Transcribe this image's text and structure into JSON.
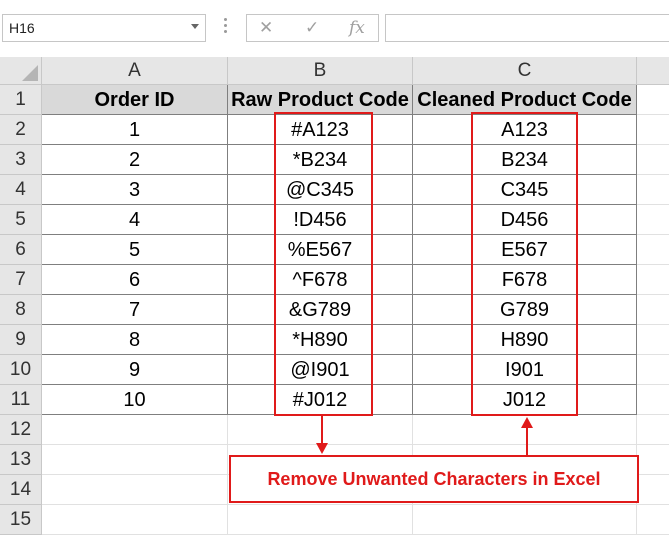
{
  "namebox": {
    "value": "H16"
  },
  "formula_buttons": {
    "cancel": "✕",
    "enter": "✓",
    "fx": "fx"
  },
  "columns": [
    "A",
    "B",
    "C"
  ],
  "rows": [
    "1",
    "2",
    "3",
    "4",
    "5",
    "6",
    "7",
    "8",
    "9",
    "10",
    "11",
    "12",
    "13",
    "14",
    "15"
  ],
  "table": {
    "headers": [
      "Order ID",
      "Raw Product Code",
      "Cleaned Product Code"
    ],
    "data": [
      [
        "1",
        "#A123",
        "A123"
      ],
      [
        "2",
        "*B234",
        "B234"
      ],
      [
        "3",
        "@C345",
        "C345"
      ],
      [
        "4",
        "!D456",
        "D456"
      ],
      [
        "5",
        "%E567",
        "E567"
      ],
      [
        "6",
        "^F678",
        "F678"
      ],
      [
        "7",
        "&G789",
        "G789"
      ],
      [
        "8",
        "*H890",
        "H890"
      ],
      [
        "9",
        "@I901",
        "I901"
      ],
      [
        "10",
        "#J012",
        "J012"
      ]
    ]
  },
  "callout": {
    "text": "Remove Unwanted Characters in Excel"
  },
  "colors": {
    "annotation_red": "#e01a1a",
    "header_fill": "#d9d9d9",
    "chrome_gray": "#e6e6e6"
  }
}
